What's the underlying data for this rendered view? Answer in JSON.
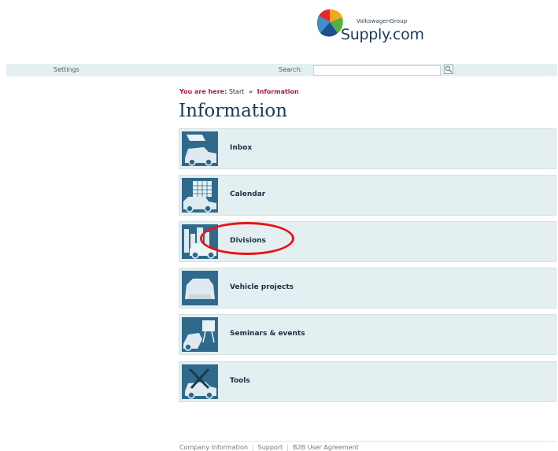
{
  "brand": {
    "group_name": "VolkswagenGroup",
    "site_name": "Supply.com",
    "colors": [
      "#e8262b",
      "#f3a81c",
      "#5ab03c",
      "#1f4f8a"
    ]
  },
  "topbar": {
    "settings_label": "Settings",
    "search_label": "Search:",
    "search_value": "",
    "search_icon": "magnifier-icon"
  },
  "breadcrumb": {
    "prefix": "You are here:",
    "items": [
      "Start",
      "Information"
    ],
    "separator": "»"
  },
  "page": {
    "title": "Information"
  },
  "menu": {
    "items": [
      {
        "label": "Inbox",
        "icon": "inbox-icon"
      },
      {
        "label": "Calendar",
        "icon": "calendar-icon"
      },
      {
        "label": "Divisions",
        "icon": "divisions-icon"
      },
      {
        "label": "Vehicle projects",
        "icon": "vehicle-projects-icon"
      },
      {
        "label": "Seminars & events",
        "icon": "seminars-icon"
      },
      {
        "label": "Tools",
        "icon": "tools-icon"
      }
    ],
    "highlighted_item": "Divisions"
  },
  "footer": {
    "links": [
      "Company Information",
      "Support",
      "B2B User Agreement"
    ]
  },
  "colors": {
    "accent": "#a1203a",
    "tile_bg": "#e4eff1",
    "icon_bg": "#2e6a8c",
    "annotation": "#e8141b"
  }
}
